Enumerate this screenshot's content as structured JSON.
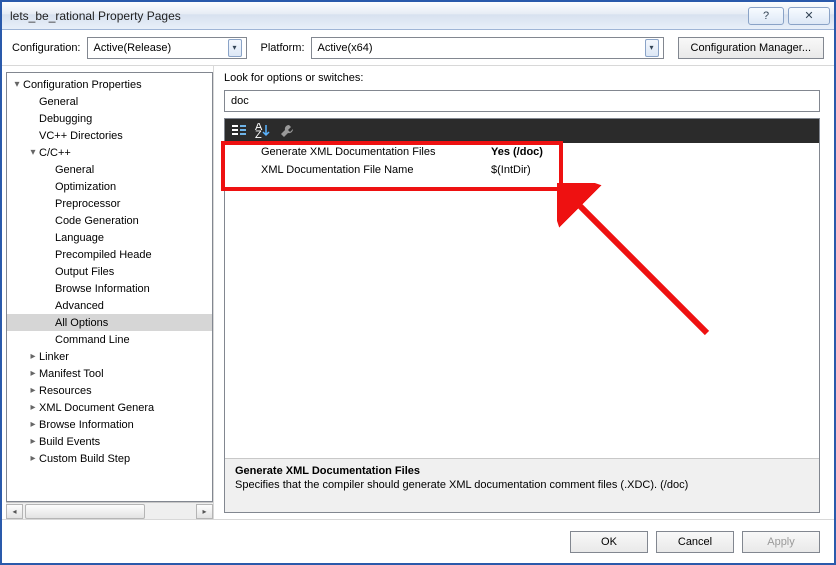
{
  "window": {
    "title": "lets_be_rational Property Pages"
  },
  "top": {
    "config_label": "Configuration:",
    "config_value": "Active(Release)",
    "platform_label": "Platform:",
    "platform_value": "Active(x64)",
    "config_mgr": "Configuration Manager..."
  },
  "tree": {
    "root": "Configuration Properties",
    "items": [
      "General",
      "Debugging",
      "VC++ Directories"
    ],
    "cpp": "C/C++",
    "cpp_items": [
      "General",
      "Optimization",
      "Preprocessor",
      "Code Generation",
      "Language",
      "Precompiled Heade",
      "Output Files",
      "Browse Information",
      "Advanced",
      "All Options",
      "Command Line"
    ],
    "rest": [
      "Linker",
      "Manifest Tool",
      "Resources",
      "XML Document Genera",
      "Browse Information",
      "Build Events",
      "Custom Build Step"
    ]
  },
  "main": {
    "look_label": "Look for options or switches:",
    "search_value": "doc",
    "rows": [
      {
        "k": "Generate XML Documentation Files",
        "v": "Yes (/doc)",
        "bold": true
      },
      {
        "k": "XML Documentation File Name",
        "v": "$(IntDir)",
        "bold": false
      }
    ],
    "desc_title": "Generate XML Documentation Files",
    "desc_text": "Specifies that the compiler should generate XML documentation comment files (.XDC).     (/doc)"
  },
  "footer": {
    "ok": "OK",
    "cancel": "Cancel",
    "apply": "Apply"
  }
}
